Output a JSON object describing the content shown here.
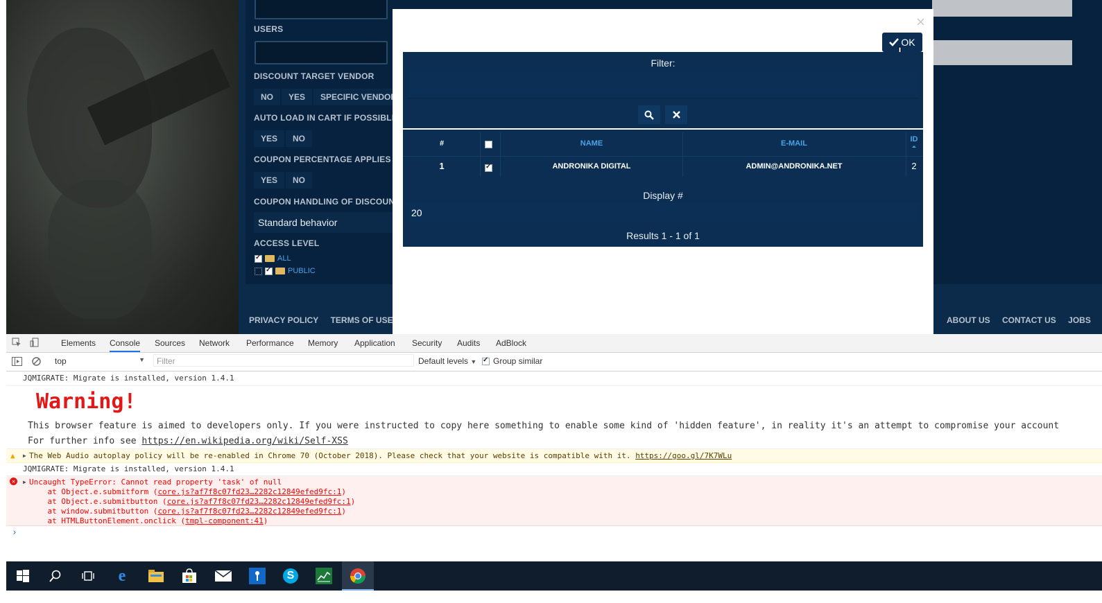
{
  "form": {
    "users_label": "USERS",
    "discount_target_label": "DISCOUNT TARGET VENDOR",
    "discount_target_options": [
      "NO",
      "YES",
      "SPECIFIC VENDOR"
    ],
    "auto_load_label": "AUTO LOAD IN CART IF POSSIBLE",
    "auto_load_options": [
      "YES",
      "NO"
    ],
    "coupon_pct_label": "COUPON PERCENTAGE APPLIES TO",
    "coupon_pct_options": [
      "YES",
      "NO"
    ],
    "coupon_handling_label": "COUPON HANDLING OF DISCOUNT",
    "coupon_handling_value": "Standard behavior",
    "access_level_label": "ACCESS LEVEL",
    "access_items": [
      "ALL",
      "PUBLIC"
    ]
  },
  "footer": {
    "left": [
      "PRIVACY POLICY",
      "TERMS OF USE"
    ],
    "right": [
      "ABOUT US",
      "CONTACT US",
      "JOBS"
    ]
  },
  "modal": {
    "close_glyph": "×",
    "ok_label": "OK",
    "filter_title": "Filter:",
    "columns": [
      "#",
      "NAME",
      "E-MAIL",
      "ID"
    ],
    "row": {
      "num": "1",
      "name": "ANDRONIKA DIGITAL",
      "email": "ADMIN@ANDRONIKA.NET",
      "id": "2"
    },
    "display_title": "Display #",
    "display_value": "20",
    "results": "Results 1 - 1 of 1"
  },
  "devtools": {
    "tabs": [
      "Elements",
      "Console",
      "Sources",
      "Network",
      "Performance",
      "Memory",
      "Application",
      "Security",
      "Audits",
      "AdBlock"
    ],
    "active_tab": "Console",
    "context": "top",
    "filter_placeholder": "Filter",
    "levels": "Default levels",
    "group_similar": "Group similar",
    "lines": {
      "jqmigrate1": "JQMIGRATE: Migrate is installed, version 1.4.1",
      "warning": "Warning!",
      "warn_text": "This browser feature is aimed to developers only. If you were instructed to copy here something to enable some kind of 'hidden feature', in reality it's an attempt to compromise your account",
      "info_text": "For further info see ",
      "info_link": "https://en.wikipedia.org/wiki/Self-XSS",
      "audio_text": "The Web Audio autoplay policy will be re-enabled in Chrome 70 (October 2018). Please check that your website is compatible with it. ",
      "audio_link": "https://goo.gl/7K7WLu",
      "jqmigrate2": "JQMIGRATE: Migrate is installed, version 1.4.1",
      "error_title": "Uncaught TypeError: Cannot read property 'task' of null",
      "stack": [
        {
          "at": "    at Object.e.submitform (",
          "link": "core.js?af7f8c07fd23…2282c12849efed9fc:1",
          "end": ")"
        },
        {
          "at": "    at Object.e.submitbutton (",
          "link": "core.js?af7f8c07fd23…2282c12849efed9fc:1",
          "end": ")"
        },
        {
          "at": "    at window.submitbutton (",
          "link": "core.js?af7f8c07fd23…2282c12849efed9fc:1",
          "end": ")"
        },
        {
          "at": "    at HTMLButtonElement.onclick (",
          "link": "tmpl-component:41",
          "end": ")"
        }
      ],
      "prompt": "›"
    }
  },
  "taskbar": {
    "icons": [
      "windows-start-icon",
      "search-icon",
      "task-view-icon",
      "edge-icon",
      "file-explorer-icon",
      "store-icon",
      "mail-icon",
      "keepass-icon",
      "skype-icon",
      "chart-app-icon",
      "chrome-icon"
    ]
  }
}
